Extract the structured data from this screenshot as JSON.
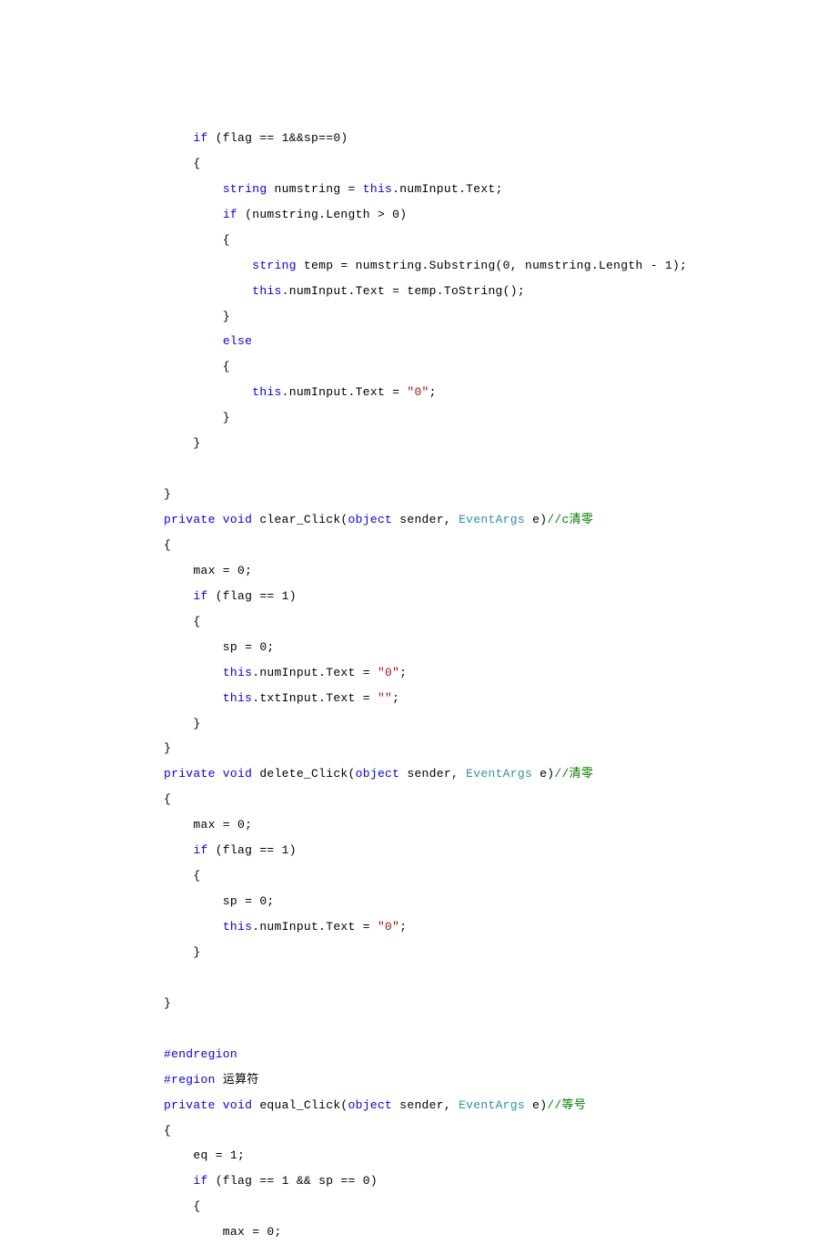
{
  "code": {
    "l0": "",
    "l1a": "if",
    "l1b": " (flag == 1&&sp==0)",
    "l2": "    {",
    "l3a": "string",
    "l3b": " numstring = ",
    "l3c": "this",
    "l3d": ".numInput.Text;",
    "l4a": "if",
    "l4b": " (numstring.Length > 0)",
    "l5": "        {",
    "l6a": "string",
    "l6b": " temp = numstring.Substring(0, numstring.Length - 1);",
    "l7a": "this",
    "l7b": ".numInput.Text = temp.ToString();",
    "l8": "        }",
    "l9a": "else",
    "l10": "        {",
    "l11a": "this",
    "l11b": ".numInput.Text = ",
    "l11c": "\"0\"",
    "l11d": ";",
    "l12": "        }",
    "l13": "    }",
    "l14": "",
    "l15": "}",
    "l16a": "private void",
    "l16b": " clear_Click(",
    "l16c": "object",
    "l16d": " sender, ",
    "l16e": "EventArgs",
    "l16f": " e)",
    "l16g": "//c清零",
    "l17": "{",
    "l18": "    max = 0;",
    "l19a": "if",
    "l19b": " (flag == 1)",
    "l20": "    {",
    "l21": "        sp = 0;",
    "l22a": "this",
    "l22b": ".numInput.Text = ",
    "l22c": "\"0\"",
    "l22d": ";",
    "l23a": "this",
    "l23b": ".txtInput.Text = ",
    "l23c": "\"\"",
    "l23d": ";",
    "l24": "    }",
    "l25": "}",
    "l26a": "private void",
    "l26b": " delete_Click(",
    "l26c": "object",
    "l26d": " sender, ",
    "l26e": "EventArgs",
    "l26f": " e)",
    "l26g": "//清零",
    "l27": "{",
    "l28": "    max = 0;",
    "l29a": "if",
    "l29b": " (flag == 1)",
    "l30": "    {",
    "l31": "        sp = 0;",
    "l32a": "this",
    "l32b": ".numInput.Text = ",
    "l32c": "\"0\"",
    "l32d": ";",
    "l33": "    }",
    "l34": "",
    "l35": "}",
    "l36": "",
    "l37a": "#endregion",
    "l38a": "#region",
    "l38b": " 运算符",
    "l39a": "private void",
    "l39b": " equal_Click(",
    "l39c": "object",
    "l39d": " sender, ",
    "l39e": "EventArgs",
    "l39f": " e)",
    "l39g": "//等号",
    "l40": "{",
    "l41": "    eq = 1;",
    "l42a": "if",
    "l42b": " (flag == 1 && sp == 0)",
    "l43": "    {",
    "l44": "        max = 0;"
  }
}
